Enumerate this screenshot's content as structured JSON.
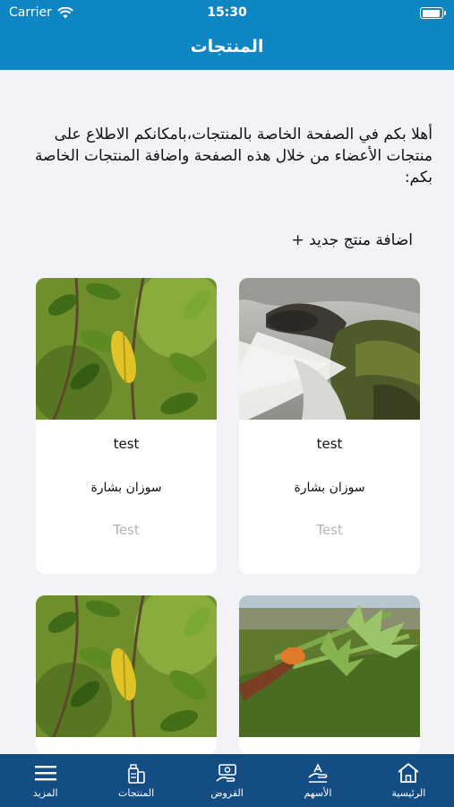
{
  "status_bar": {
    "carrier": "Carrier",
    "time": "15:30"
  },
  "nav": {
    "title": "المنتجات"
  },
  "intro_text": "أهلا بكم في الصفحة الخاصة بالمنتجات،بامكانكم الاطلاع على منتجات الأعضاء من خلال هذه الصفحة واضافة المنتجات الخاصة بكم:",
  "add_product_label": "اضافة منتج جديد +",
  "products": [
    {
      "title": "test",
      "owner": "سوزان بشارة",
      "description": "Test",
      "image": "waterfall-photo"
    },
    {
      "title": "test",
      "owner": "سوزان بشارة",
      "description": "Test",
      "image": "leaves-photo"
    },
    {
      "image": "thistle-photo"
    },
    {
      "image": "leaves-photo"
    }
  ],
  "tabs": [
    {
      "label": "الرئيسية",
      "icon": "home-icon"
    },
    {
      "label": "الأسهم",
      "icon": "shares-icon"
    },
    {
      "label": "القروض",
      "icon": "loans-icon"
    },
    {
      "label": "المنتجات",
      "icon": "products-icon"
    },
    {
      "label": "المزيد",
      "icon": "menu-icon"
    }
  ],
  "colors": {
    "header": "#0f86c4",
    "tabbar": "#144d84",
    "background": "#f2f2f7"
  }
}
